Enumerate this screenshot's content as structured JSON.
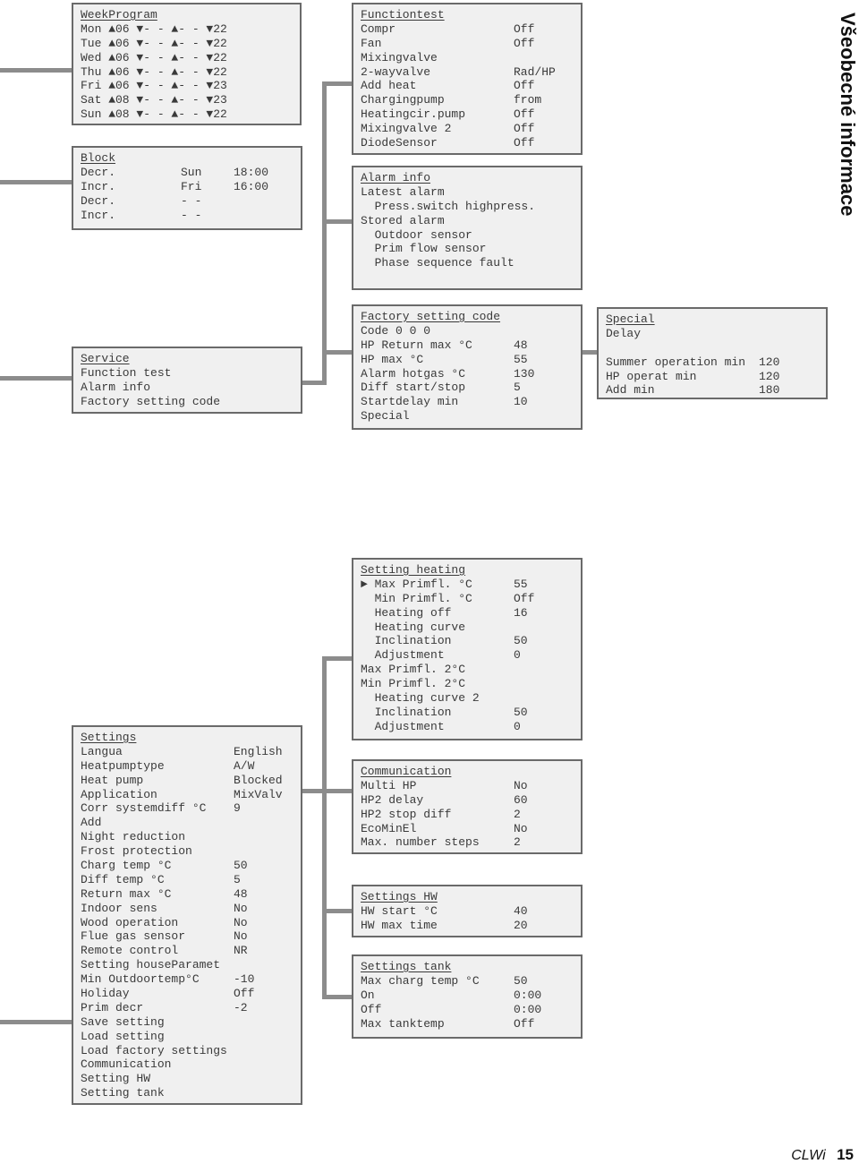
{
  "side_title": "Všeobecné informace",
  "footer": {
    "brand": "CLWi",
    "page": "15"
  },
  "boxes": {
    "weekprogram": {
      "title": "WeekProgram",
      "rows": [
        [
          "Mon ▲06 ▼- - ▲- - ▼22"
        ],
        [
          "Tue ▲06 ▼- - ▲- - ▼22"
        ],
        [
          "Wed ▲06 ▼- - ▲- - ▼22"
        ],
        [
          "Thu ▲06 ▼- - ▲- - ▼22"
        ],
        [
          "Fri ▲06 ▼- - ▲- - ▼23"
        ],
        [
          "Sat ▲08 ▼- - ▲- - ▼23"
        ],
        [
          "Sun ▲08 ▼- - ▲- - ▼22"
        ]
      ]
    },
    "block": {
      "title": "Block",
      "rows3": [
        [
          "Decr.",
          "Sun",
          "18:00"
        ],
        [
          "Incr.",
          "Fri",
          "16:00"
        ],
        [
          "Decr.",
          "- -",
          ""
        ],
        [
          "Incr.",
          "- -",
          ""
        ]
      ]
    },
    "service": {
      "title": "Service",
      "rows": [
        [
          "Function test"
        ],
        [
          "Alarm info"
        ],
        [
          "Factory setting code"
        ]
      ]
    },
    "functiontest": {
      "title": "Functiontest",
      "rows": [
        [
          "Compr",
          "Off"
        ],
        [
          "Fan",
          "Off"
        ],
        [
          "Mixingvalve",
          ""
        ],
        [
          "2-wayvalve",
          "Rad/HP"
        ],
        [
          "Add heat",
          "Off"
        ],
        [
          "Chargingpump",
          "from"
        ],
        [
          "Heatingcir.pump",
          "Off"
        ],
        [
          "Mixingvalve 2",
          "Off"
        ],
        [
          "DiodeSensor",
          "Off"
        ]
      ]
    },
    "alarminfo": {
      "title": "Alarm info",
      "rows": [
        [
          "Latest alarm"
        ],
        [
          "  Press.switch highpress."
        ],
        [
          "Stored alarm"
        ],
        [
          "  Outdoor sensor"
        ],
        [
          "  Prim flow sensor"
        ],
        [
          "  Phase sequence fault"
        ]
      ]
    },
    "factory": {
      "title": "Factory setting code",
      "rows": [
        [
          "Code 0 0 0",
          ""
        ],
        [
          "HP Return max °C",
          "48"
        ],
        [
          "HP max °C",
          "55"
        ],
        [
          "Alarm hotgas °C",
          "130"
        ],
        [
          "Diff start/stop",
          "5"
        ],
        [
          "Startdelay min",
          "10"
        ],
        [
          "Special",
          ""
        ]
      ]
    },
    "special": {
      "title": "Special",
      "rows": [
        [
          "Delay",
          ""
        ],
        [
          "",
          ""
        ],
        [
          "Summer operation min",
          "120"
        ],
        [
          "HP operat min",
          "120"
        ],
        [
          "Add min",
          "180"
        ]
      ]
    },
    "settings": {
      "title": "Settings",
      "rows": [
        [
          "Langua",
          "English"
        ],
        [
          "Heatpumptype",
          "A/W"
        ],
        [
          "Heat pump",
          "Blocked"
        ],
        [
          "Application",
          "MixValv"
        ],
        [
          "Corr systemdiff °C",
          "9"
        ],
        [
          "Add",
          ""
        ],
        [
          "Night reduction",
          ""
        ],
        [
          "Frost protection",
          ""
        ],
        [
          "Charg temp °C",
          "50"
        ],
        [
          "Diff temp °C",
          "5"
        ],
        [
          "Return max °C",
          "48"
        ],
        [
          "Indoor sens",
          "No"
        ],
        [
          "Wood operation",
          "No"
        ],
        [
          "Flue gas sensor",
          "No"
        ],
        [
          "Remote control",
          "NR"
        ],
        [
          "Setting houseParamet",
          ""
        ],
        [
          "Min Outdoortemp°C",
          "-10"
        ],
        [
          "Holiday",
          "Off"
        ],
        [
          "Prim decr",
          "-2"
        ],
        [
          "Save setting",
          ""
        ],
        [
          "Load setting",
          ""
        ],
        [
          "Load factory settings",
          ""
        ],
        [
          "Communication",
          ""
        ],
        [
          "Setting HW",
          ""
        ],
        [
          "Setting tank",
          ""
        ]
      ]
    },
    "heating": {
      "title": "Setting heating",
      "rows": [
        [
          "► Max Primfl. °C",
          "55"
        ],
        [
          "  Min Primfl. °C",
          "Off"
        ],
        [
          "  Heating off",
          "16"
        ],
        [
          "  Heating curve",
          ""
        ],
        [
          "  Inclination",
          "50"
        ],
        [
          "  Adjustment",
          "0"
        ],
        [
          "Max Primfl. 2°C",
          ""
        ],
        [
          "Min Primfl. 2°C",
          ""
        ],
        [
          "  Heating curve 2",
          ""
        ],
        [
          "  Inclination",
          "50"
        ],
        [
          "  Adjustment",
          "0"
        ]
      ]
    },
    "communication": {
      "title": "Communication",
      "rows": [
        [
          "Multi HP",
          "No"
        ],
        [
          "HP2 delay",
          "60"
        ],
        [
          "HP2 stop diff",
          "2"
        ],
        [
          "EcoMinEl",
          "No"
        ],
        [
          "Max. number steps",
          "2"
        ]
      ]
    },
    "hw": {
      "title": "Settings HW",
      "rows": [
        [
          "HW start °C",
          "40"
        ],
        [
          "HW max time",
          "20"
        ]
      ]
    },
    "tank": {
      "title": "Settings tank",
      "rows": [
        [
          "Max charg temp °C",
          "50"
        ],
        [
          "On",
          "0:00"
        ],
        [
          "Off",
          "0:00"
        ],
        [
          "Max tanktemp",
          "Off"
        ]
      ]
    }
  }
}
